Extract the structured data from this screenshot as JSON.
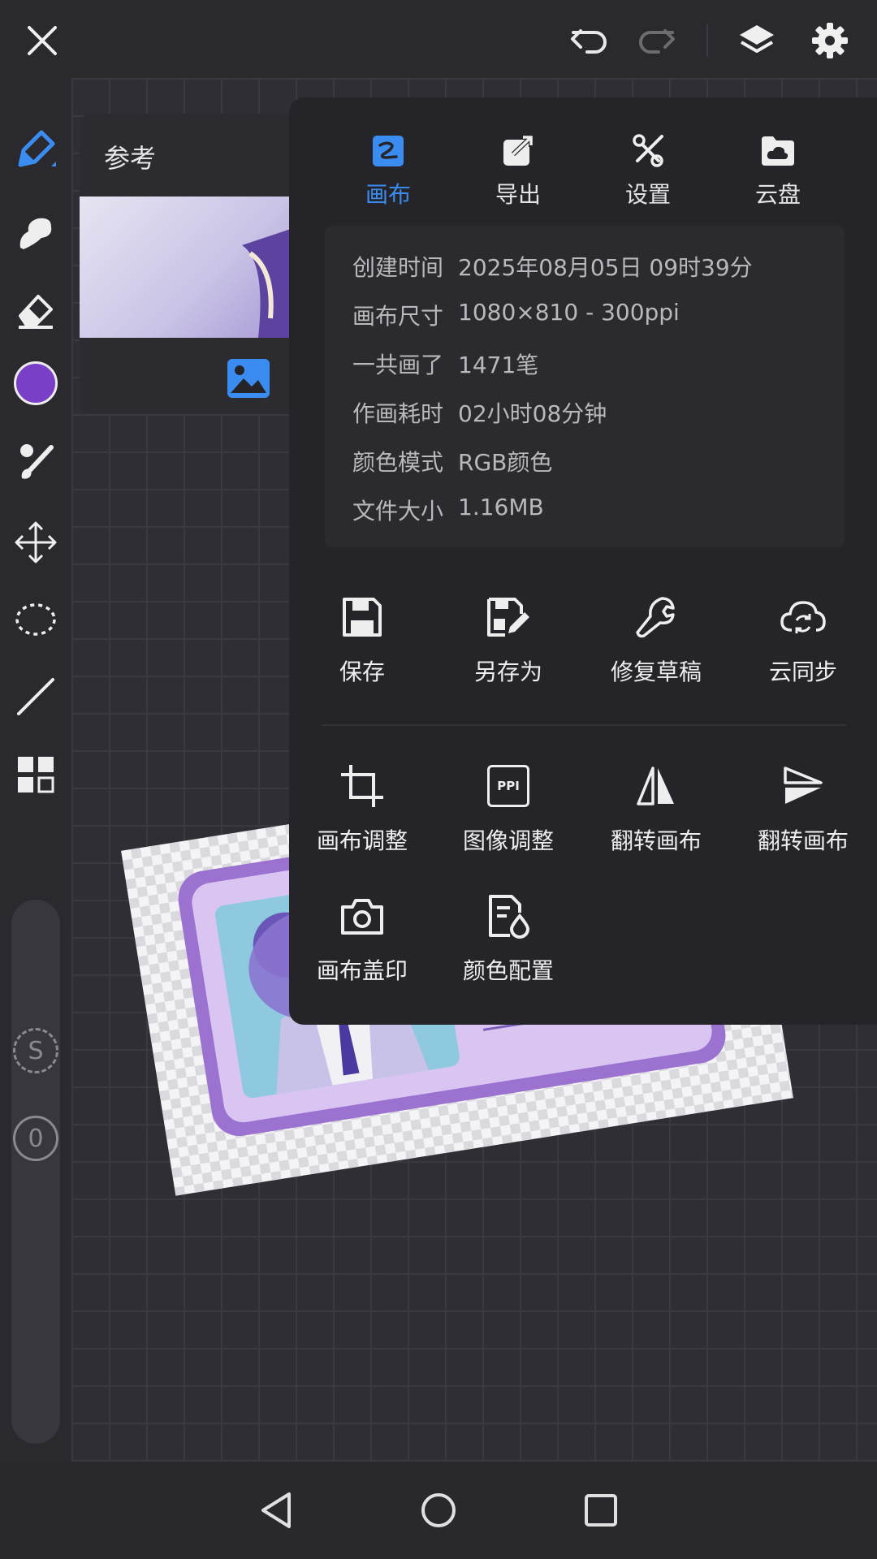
{
  "topbar": {
    "close_icon": "close-icon",
    "undo_icon": "undo-icon",
    "redo_icon": "redo-icon",
    "layers_icon": "layers-icon",
    "settings_icon": "gear-icon"
  },
  "colors": {
    "accent": "#3b8cf0",
    "current_color": "#7a3fc7",
    "panel": "#252428"
  },
  "sidebar": {
    "tools": [
      "pen-icon",
      "smudge-icon",
      "eraser-icon",
      "color-swatch",
      "brush-palette-icon",
      "move-icon",
      "lasso-icon",
      "line-icon",
      "grid-icon"
    ],
    "s_label": "S",
    "zero_label": "0"
  },
  "reference": {
    "title": "参考"
  },
  "menu": {
    "tabs": [
      {
        "label": "画布",
        "active": true
      },
      {
        "label": "导出"
      },
      {
        "label": "设置"
      },
      {
        "label": "云盘"
      }
    ],
    "info": [
      {
        "key": "创建时间",
        "value": "2025年08月05日 09时39分"
      },
      {
        "key": "画布尺寸",
        "value": "1080×810 - 300ppi"
      },
      {
        "key": "一共画了",
        "value": "1471笔"
      },
      {
        "key": "作画耗时",
        "value": "02小时08分钟"
      },
      {
        "key": "颜色模式",
        "value": "RGB颜色"
      },
      {
        "key": "文件大小",
        "value": "1.16MB"
      }
    ],
    "actions_row1": [
      "保存",
      "另存为",
      "修复草稿",
      "云同步"
    ],
    "actions_row2": [
      "画布调整",
      "图像调整",
      "翻转画布",
      "翻转画布"
    ],
    "actions_row3": [
      "画布盖印",
      "颜色配置"
    ],
    "ppi_badge": "PPI"
  }
}
